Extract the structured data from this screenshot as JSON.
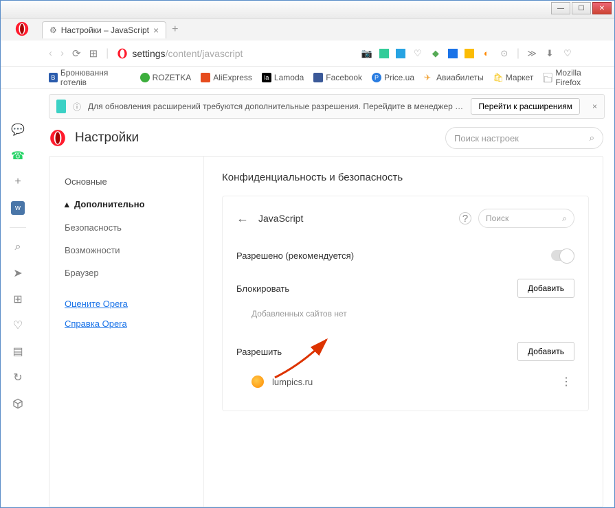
{
  "window": {
    "title": "Настройки – JavaScript"
  },
  "tab": {
    "title": "Настройки – JavaScript"
  },
  "url": {
    "protocol": "settings",
    "path": "/content/javascript"
  },
  "bookmarks": [
    {
      "label": "Бронювання готелів",
      "color": "#2b5cad"
    },
    {
      "label": "ROZETKA",
      "color": "#3cae3c"
    },
    {
      "label": "AliExpress",
      "color": "#e64c1e"
    },
    {
      "label": "Lamoda",
      "color": "#000"
    },
    {
      "label": "Facebook",
      "color": "#3b5998"
    },
    {
      "label": "Price.ua",
      "color": "#2a7de1"
    },
    {
      "label": "Авиабилеты",
      "color": "#f0a030"
    },
    {
      "label": "Маркет",
      "color": "#f6c000"
    },
    {
      "label": "Mozilla Firefox",
      "color": "#ccc"
    }
  ],
  "notification": {
    "text": "Для обновления расширений требуются дополнительные разрешения. Перейдите в менеджер расширений для подт…",
    "button": "Перейти к расширениям"
  },
  "settings": {
    "title": "Настройки",
    "search_placeholder": "Поиск настроек",
    "sidebar": {
      "main": "Основные",
      "advanced": "Дополнительно",
      "security": "Безопасность",
      "features": "Возможности",
      "browser": "Браузер",
      "rate": "Оцените Opera",
      "help": "Справка Opera"
    },
    "section": {
      "title": "Конфиденциальность и безопасность",
      "panel_title": "JavaScript",
      "search_placeholder": "Поиск",
      "allowed_label": "Разрешено (рекомендуется)",
      "block_heading": "Блокировать",
      "block_empty": "Добавленных сайтов нет",
      "allow_heading": "Разрешить",
      "add_button": "Добавить",
      "site": "lumpics.ru"
    }
  }
}
